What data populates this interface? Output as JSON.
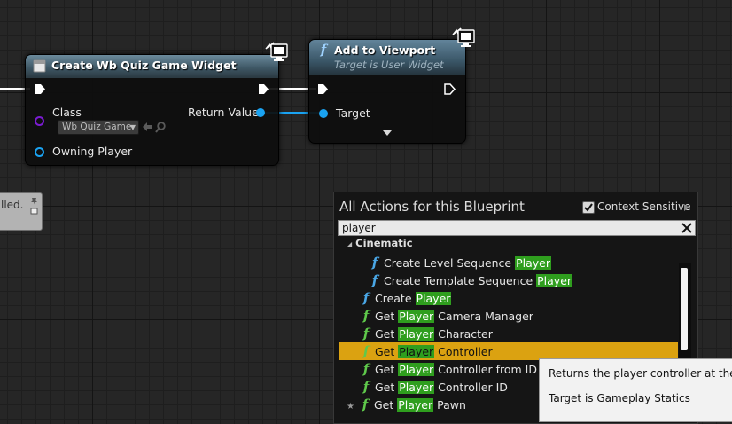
{
  "create_node": {
    "title": "Create Wb Quiz Game Widget",
    "class_label": "Class",
    "class_value": "Wb Quiz Game",
    "return_label": "Return Value",
    "owning_label": "Owning Player"
  },
  "add_node": {
    "title": "Add to Viewport",
    "subtitle": "Target is User Widget",
    "target_label": "Target"
  },
  "comment": {
    "text": "lled."
  },
  "menu": {
    "title": "All Actions for this Blueprint",
    "context_label": "Context Sensitive",
    "search_value": "player",
    "category": "Cinematic",
    "items": [
      {
        "pre": "Create Level Sequence ",
        "hl": "Player",
        "post": ""
      },
      {
        "pre": "Create Template Sequence ",
        "hl": "Player",
        "post": ""
      },
      {
        "pre": "Create ",
        "hl": "Player",
        "post": ""
      },
      {
        "pre": "Get ",
        "hl": "Player",
        "post": " Camera Manager"
      },
      {
        "pre": "Get ",
        "hl": "Player",
        "post": " Character"
      },
      {
        "pre": "Get ",
        "hl": "Player",
        "post": " Controller"
      },
      {
        "pre": "Get ",
        "hl": "Player",
        "post": " Controller from ID"
      },
      {
        "pre": "Get ",
        "hl": "Player",
        "post": " Controller ID"
      },
      {
        "pre": "Get ",
        "hl": "Player",
        "post": " Pawn"
      }
    ]
  },
  "tooltip": {
    "line1": "Returns the player controller at the spe",
    "line2": "Target is Gameplay Statics"
  },
  "colors": {
    "exec_wire": "#ffffff",
    "object_wire": "#1aa3f2",
    "selection": "#dba211",
    "highlight": "#2f9e1e"
  }
}
